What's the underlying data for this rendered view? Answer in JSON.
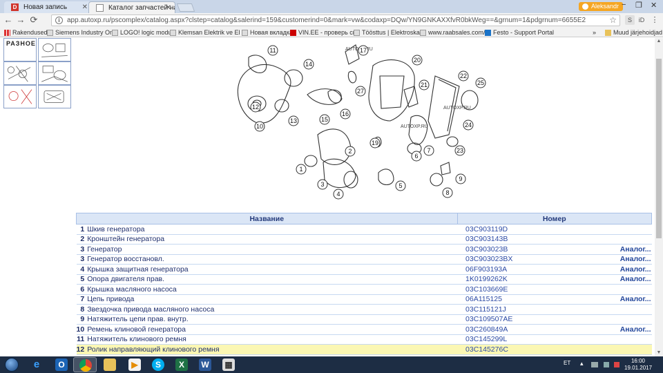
{
  "browser": {
    "tabs": [
      {
        "title": "Новая запись",
        "active": false
      },
      {
        "title": "Каталог запчастей на Al",
        "active": true
      }
    ],
    "profile": "Aleksandr",
    "window_controls": [
      "−",
      "❐",
      "✕"
    ],
    "url": "app.autoxp.ru/pscomplex/catalog.aspx?clstep=catalog&salerind=159&customerind=0&mark=vw&codaxp=DQw/YN9GNKAXXfvR0bkWeg==&grnum=1&pdgrnum=6655E2",
    "extensions": [
      "S",
      "iD",
      "⋮"
    ],
    "bookmarks": [
      "Rakendused",
      "Siemens Industry Onli",
      "LOGO! logic module",
      "Klemsan Elektrik ve El",
      "Новая вкладка",
      "VIN.EE - проверь сво",
      "Töösttus | Elektroskan",
      "www.raabsales.com/fi",
      "Festo - Support Portal"
    ],
    "bookmarks_more": "»",
    "bookmarks_other": "Muud järjehoidjad"
  },
  "sidebar": {
    "label": "РАЗНОЕ"
  },
  "diagram": {
    "watermarks": [
      "AUTOXP.RU",
      "AUTOXP.RU",
      "AUTOXP.RU"
    ],
    "callouts": [
      "1",
      "2",
      "3",
      "4",
      "5",
      "6",
      "7",
      "8",
      "9",
      "10",
      "11",
      "12",
      "13",
      "14",
      "15",
      "16",
      "17",
      "19",
      "20",
      "21",
      "22",
      "23",
      "24",
      "25",
      "27"
    ]
  },
  "table": {
    "headers": {
      "name": "Название",
      "code": "Номер"
    },
    "rows": [
      {
        "num": "1",
        "name": "Шкив генератора",
        "code": "03C903119D",
        "analog": ""
      },
      {
        "num": "2",
        "name": "Кронштейн генератора",
        "code": "03C903143B",
        "analog": ""
      },
      {
        "num": "3",
        "name": "Генератор",
        "code": "03C903023B",
        "analog": "Аналог..."
      },
      {
        "num": "3",
        "name": "Генератор восстановл.",
        "code": "03C903023BX",
        "analog": "Аналог..."
      },
      {
        "num": "4",
        "name": "Крышка защитная генератора",
        "code": "06F903193A",
        "analog": "Аналог..."
      },
      {
        "num": "5",
        "name": "Опора двигателя прав.",
        "code": "1K0199262K",
        "analog": "Аналог..."
      },
      {
        "num": "6",
        "name": "Крышка масляного насоса",
        "code": "03C103669E",
        "analog": ""
      },
      {
        "num": "7",
        "name": "Цепь привода",
        "code": "06A115125",
        "analog": "Аналог..."
      },
      {
        "num": "8",
        "name": "Звездочка привода масляного насоса",
        "code": "03C115121J",
        "analog": ""
      },
      {
        "num": "9",
        "name": "Натяжитель цепи прав. внутр.",
        "code": "03C109507AE",
        "analog": ""
      },
      {
        "num": "10",
        "name": "Ремень клиновой генератора",
        "code": "03C260849A",
        "analog": "Аналог..."
      },
      {
        "num": "11",
        "name": "Натяжитель клинового ремня",
        "code": "03C145299L",
        "analog": ""
      },
      {
        "num": "12",
        "name": "Ролик направляющий клинового ремня",
        "code": "03C145276C",
        "analog": ""
      }
    ]
  },
  "taskbar": {
    "apps": [
      "ie",
      "outlook",
      "chrome",
      "explorer",
      "media",
      "skype",
      "excel",
      "word",
      "unknown"
    ],
    "lang": "ET",
    "time": "16:00",
    "date": "19.01.2017"
  },
  "colors": {
    "header_bg": "#dbe6f6",
    "highlight_row": "#fbf7b3",
    "link": "#23479c",
    "taskbar": "#1d2d44"
  }
}
